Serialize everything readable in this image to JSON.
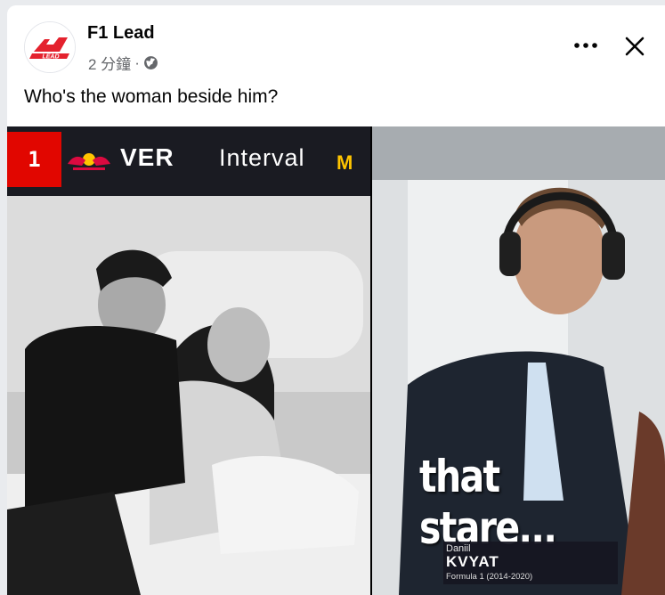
{
  "post": {
    "author": "F1 Lead",
    "time": "2 分鐘",
    "separator": "·",
    "privacy_icon": "globe-icon",
    "caption": "Who's the woman beside him?",
    "more_icon": "more-horizontal-icon",
    "close_icon": "close-icon"
  },
  "logo": {
    "text": "LEAD",
    "color": "#e4222e"
  },
  "left_image": {
    "position": "1",
    "driver": "VER",
    "interval_label": "Interval",
    "interval_mark": "M",
    "team_icon": "red-bull-logo",
    "accent": "#e10600"
  },
  "right_image": {
    "overlay_text": "that stare...",
    "first_name": "Daniil",
    "last_name": "KVYAT",
    "subtitle": "Formula 1 (2014-2020)"
  },
  "colors": {
    "text_primary": "#050505",
    "text_secondary": "#65676b"
  }
}
